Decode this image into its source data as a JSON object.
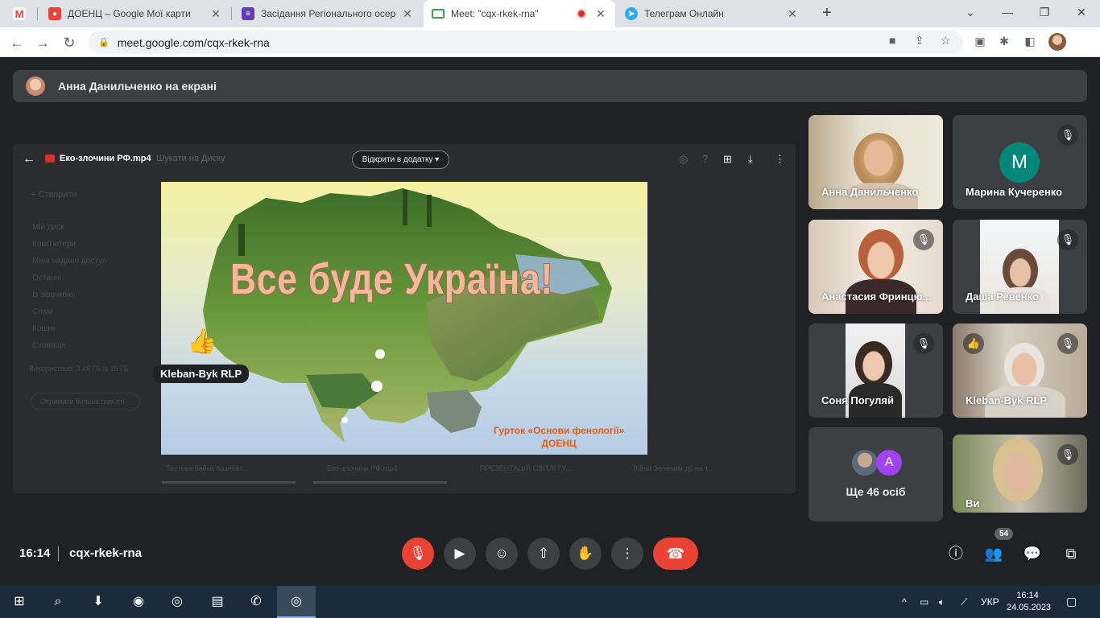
{
  "browser": {
    "tabs": [
      {
        "title": "",
        "icon": "gmail-icon"
      },
      {
        "title": "ДОЕНЦ – Google Мої карти",
        "icon": "maps-icon"
      },
      {
        "title": "Засідання Регіонального осеред",
        "icon": "forms-icon"
      },
      {
        "title": "Meet: \"cqx-rkek-rna\"",
        "icon": "meet-icon",
        "active": true
      },
      {
        "title": "Телеграм Онлайн",
        "icon": "telegram-icon"
      }
    ],
    "url": "meet.google.com/cqx-rkek-rna"
  },
  "presenting_banner": "Анна Данильченко на екрані",
  "shared_screen": {
    "file_name": "Еко-злочини РФ.mp4",
    "search_placeholder": "Шукати на Диску",
    "open_with_label": "Відкрити в додатку",
    "sidebar": {
      "create": "Створити",
      "items": [
        "Мій диск",
        "Комп'ютери",
        "Мені надано доступ",
        "Останні",
        "Із зірочкою",
        "Спам",
        "Кошик",
        "Сховище"
      ],
      "storage_text": "Використано: 3,48 ГБ із 15 ГБ",
      "upgrade": "Отримати більше пам'яті"
    },
    "bottom_files": [
      "Тестова байка Козловт...",
      "Еко-злочини РФ.mp4",
      "ПРЕЗЕНТАЦІЯ СВІТЛІ ГУ...",
      "Війна Зеленим дії на т..."
    ],
    "slide": {
      "title": "Все буде Україна!",
      "subtitle_line1": "Гурток «Основи фенології»",
      "subtitle_line2": "ДОЕНЦ"
    },
    "reaction_emoji": "👍",
    "reaction_name": "Kleban-Byk RLP"
  },
  "participants": [
    {
      "name": "Анна Данильченко",
      "muted": false
    },
    {
      "name": "Марина Кучеренко",
      "initial": "M",
      "muted": true
    },
    {
      "name": "Анастасия Фринцю...",
      "muted": true
    },
    {
      "name": "Даша Ревенко",
      "muted": true
    },
    {
      "name": "Соня Погуляй",
      "muted": true
    },
    {
      "name": "Kleban-Byk RLP",
      "muted": true,
      "hand_raised": true
    },
    {
      "name": "Ви",
      "muted": true
    }
  ],
  "more_participants": {
    "label": "Ще 46 осіб",
    "avatar_initial": "A"
  },
  "meeting": {
    "time": "16:14",
    "code": "cqx-rkek-rna",
    "participant_count": "54"
  },
  "taskbar": {
    "lang": "УКР",
    "time": "16:14",
    "date": "24.05.2023"
  },
  "colors": {
    "meet_bg": "#202124",
    "end_call": "#ea4335",
    "avatar_teal": "#00897b",
    "avatar_purple": "#a142f4"
  }
}
